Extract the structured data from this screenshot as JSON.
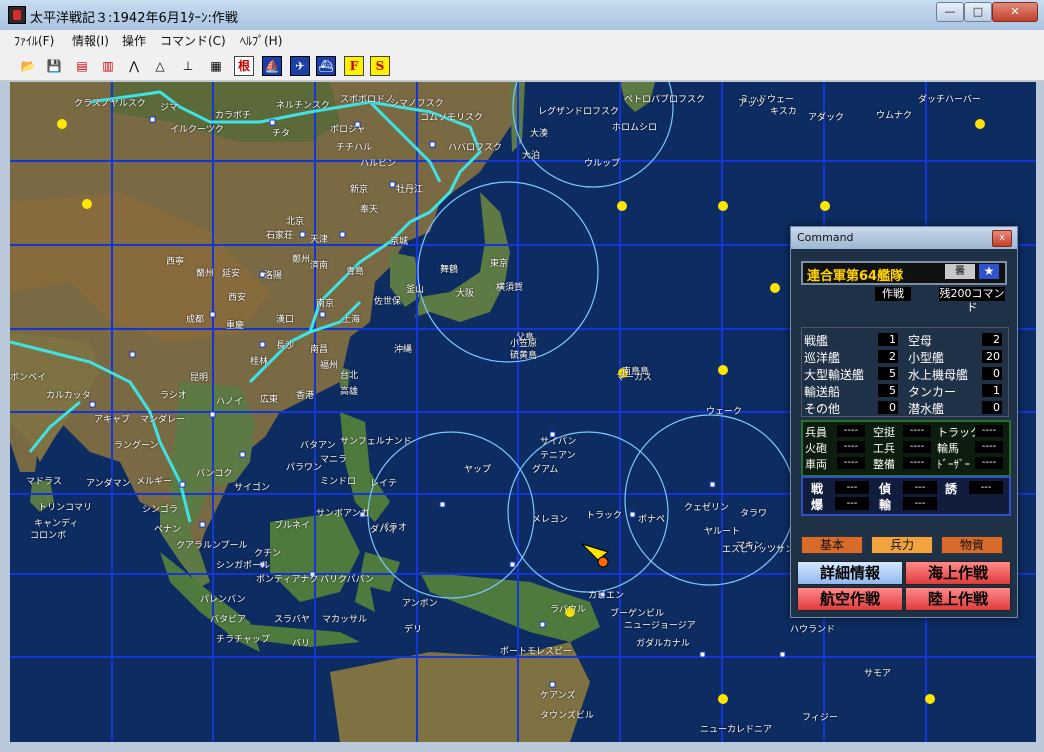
{
  "window": {
    "title": "太平洋戦記３:1942年6月1ﾀｰﾝ:作戦"
  },
  "menu": [
    "ﾌｧｲﾙ(F)",
    "情報(I)",
    "操作",
    "コマンド(C)",
    "ﾍﾙﾌﾟ(H)"
  ],
  "toolbar": {
    "text_buttons": [
      "根",
      "F",
      "S"
    ]
  },
  "map_labels": [
    "クラスノヤルスク",
    "イルクーツク",
    "ジマ",
    "カラボチ",
    "チタ",
    "ネルチンスク",
    "スボボロドノ",
    "シマノフスク",
    "コムソモリスク",
    "ハバロフスク",
    "ボロジャ",
    "チチハル",
    "ハルピン",
    "牡丹江",
    "新京",
    "奉天",
    "北京",
    "天津",
    "石家荘",
    "済南",
    "青島",
    "京城",
    "釜山",
    "舞鶴",
    "東京",
    "横須賀",
    "大阪",
    "佐世保",
    "上海",
    "南京",
    "漢口",
    "重慶",
    "成都",
    "西寧",
    "蘭州",
    "延安",
    "西安",
    "洛陽",
    "鄭州",
    "長沙",
    "南昌",
    "福州",
    "台北",
    "高雄",
    "桂林",
    "広東",
    "香港",
    "昆明",
    "ハノイ",
    "ラングーン",
    "マンダレー",
    "ラシオ",
    "アキャブ",
    "カルカッタ",
    "ボンベイ",
    "マドラス",
    "トリンコマリ",
    "キャンディ",
    "コロンボ",
    "アンダマン",
    "メルギー",
    "サイゴン",
    "バンコク",
    "シンゴラ",
    "ペナン",
    "クアラルンプール",
    "シンガポール",
    "パレンバン",
    "バタビア",
    "スラバヤ",
    "バリ",
    "チラチャップ",
    "サンボアンガ",
    "ダバオ",
    "レイテ",
    "マニラ",
    "ミンドロ",
    "パラワン",
    "サンフェルナンド",
    "バタアン",
    "ブルネイ",
    "クチン",
    "ポンティアナク",
    "バリクパパン",
    "マカッサル",
    "アンボン",
    "デリ",
    "サイパン",
    "テニアン",
    "グアム",
    "ヤップ",
    "パラオ",
    "メレヨン",
    "トラック",
    "ポナペ",
    "クェゼリン",
    "ヤルート",
    "マキン",
    "タラワ",
    "ウェーク",
    "マーカス",
    "ラバウル",
    "カビエン",
    "ブーゲンビル",
    "ニュージョージア",
    "ガダルカナル",
    "ポートモレスビー",
    "ケアンズ",
    "タウンズビル",
    "エスピリッツサント",
    "ニューカレドニア",
    "フィジー",
    "サモア",
    "ハウランド",
    "ミッドウェー",
    "アッツ",
    "キスカ",
    "アダック",
    "ウムナク",
    "ダッチハーバー",
    "ペトロパブロフスク",
    "ホロムシロ",
    "レグザンドロフスク",
    "大湊",
    "大泊",
    "ウルップ",
    "沖縄",
    "硫黄島",
    "父島",
    "南鳥島",
    "小笠原"
  ],
  "command": {
    "window_title": "Command",
    "close": "x",
    "fleet_name": "連合軍第64艦隊",
    "weather": "曇",
    "insignia": "★",
    "mode": "作戦",
    "remaining": "残200コマンド",
    "ships": [
      {
        "l": "戦艦",
        "v": "1"
      },
      {
        "l": "空母",
        "v": "2"
      },
      {
        "l": "巡洋艦",
        "v": "2"
      },
      {
        "l": "小型艦",
        "v": "20"
      },
      {
        "l": "大型輸送艦",
        "v": "5"
      },
      {
        "l": "水上機母艦",
        "v": "0"
      },
      {
        "l": "輸送船",
        "v": "5"
      },
      {
        "l": "タンカー",
        "v": "1"
      },
      {
        "l": "その他",
        "v": "0"
      },
      {
        "l": "潜水艦",
        "v": "0"
      }
    ],
    "troops": [
      {
        "l": "兵員",
        "v": "----"
      },
      {
        "l": "空挺",
        "v": "----"
      },
      {
        "l": "トラック",
        "v": "----"
      },
      {
        "l": "火砲",
        "v": "----"
      },
      {
        "l": "工兵",
        "v": "----"
      },
      {
        "l": "輸馬",
        "v": "----"
      },
      {
        "l": "車両",
        "v": "----"
      },
      {
        "l": "整備",
        "v": "----"
      },
      {
        "l": "ﾄﾞｰｻﾞｰ",
        "v": "----"
      }
    ],
    "intel": [
      {
        "l": "戦",
        "v": "---"
      },
      {
        "l": "偵",
        "v": "---"
      },
      {
        "l": "誘",
        "v": "---"
      },
      {
        "l": "爆",
        "v": "---"
      },
      {
        "l": "輸",
        "v": "---"
      }
    ],
    "tabs": [
      "基本",
      "兵力",
      "物資"
    ],
    "buttons": [
      "詳細情報",
      "海上作戦",
      "航空作戦",
      "陸上作戦"
    ]
  }
}
